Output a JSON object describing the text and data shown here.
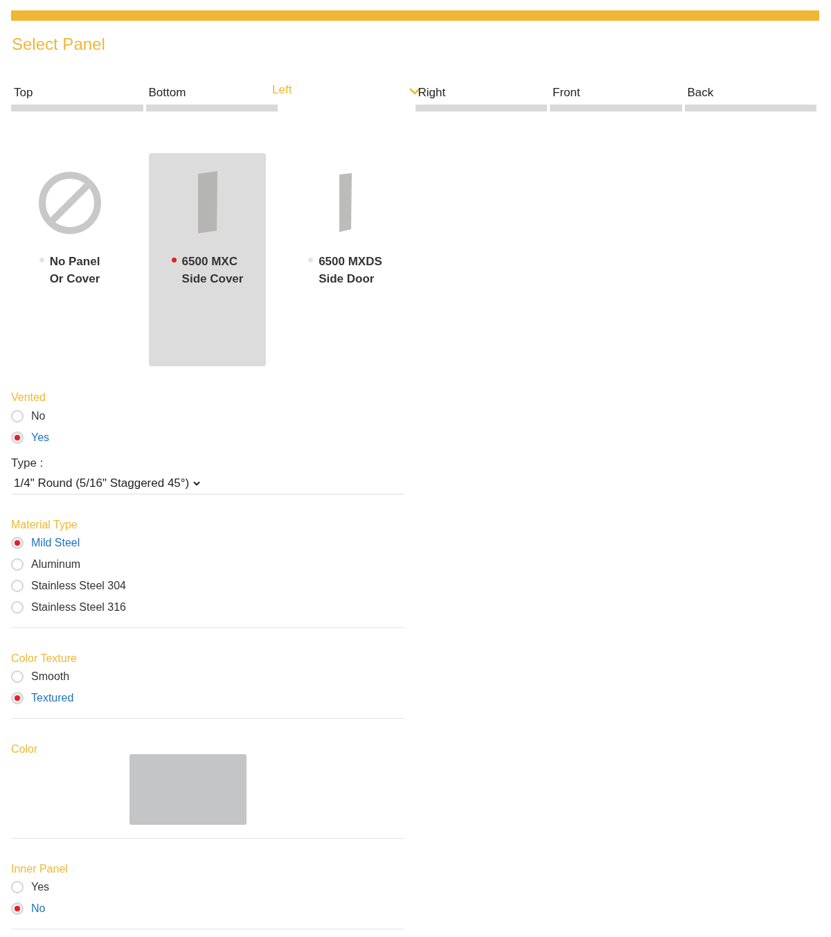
{
  "title": "Select Panel",
  "tabs": [
    {
      "label": "Top",
      "selected": false
    },
    {
      "label": "Bottom",
      "selected": false
    },
    {
      "label": "Left",
      "selected": true
    },
    {
      "label": "Right",
      "selected": false
    },
    {
      "label": "Front",
      "selected": false
    },
    {
      "label": "Back",
      "selected": false
    }
  ],
  "options": [
    {
      "kind": "none",
      "lines": [
        "No Panel",
        "Or Cover"
      ],
      "selected": false
    },
    {
      "kind": "cover",
      "lines": [
        "6500 MXC",
        "Side Cover"
      ],
      "selected": true
    },
    {
      "kind": "door",
      "lines": [
        "6500 MXDS",
        "Side Door"
      ],
      "selected": false
    }
  ],
  "sections": [
    {
      "kind": "radio",
      "title": "Vented",
      "options": [
        {
          "label": "No",
          "selected": false
        },
        {
          "label": "Yes",
          "selected": true
        }
      ]
    },
    {
      "kind": "select",
      "label": "Type :",
      "value": "1/4\" Round (5/16\" Staggered 45°)"
    },
    {
      "kind": "radio",
      "title": "Material Type",
      "options": [
        {
          "label": "Mild Steel",
          "selected": true
        },
        {
          "label": "Aluminum",
          "selected": false
        },
        {
          "label": "Stainless Steel 304",
          "selected": false
        },
        {
          "label": "Stainless Steel 316",
          "selected": false
        }
      ]
    },
    {
      "kind": "radio",
      "title": "Color Texture",
      "options": [
        {
          "label": "Smooth",
          "selected": false
        },
        {
          "label": "Textured",
          "selected": true
        }
      ]
    },
    {
      "kind": "swatch",
      "title": "Color",
      "color": "#c4c5c7"
    },
    {
      "kind": "radio",
      "title": "Inner Panel",
      "options": [
        {
          "label": "Yes",
          "selected": false
        },
        {
          "label": "No",
          "selected": true
        }
      ]
    }
  ]
}
